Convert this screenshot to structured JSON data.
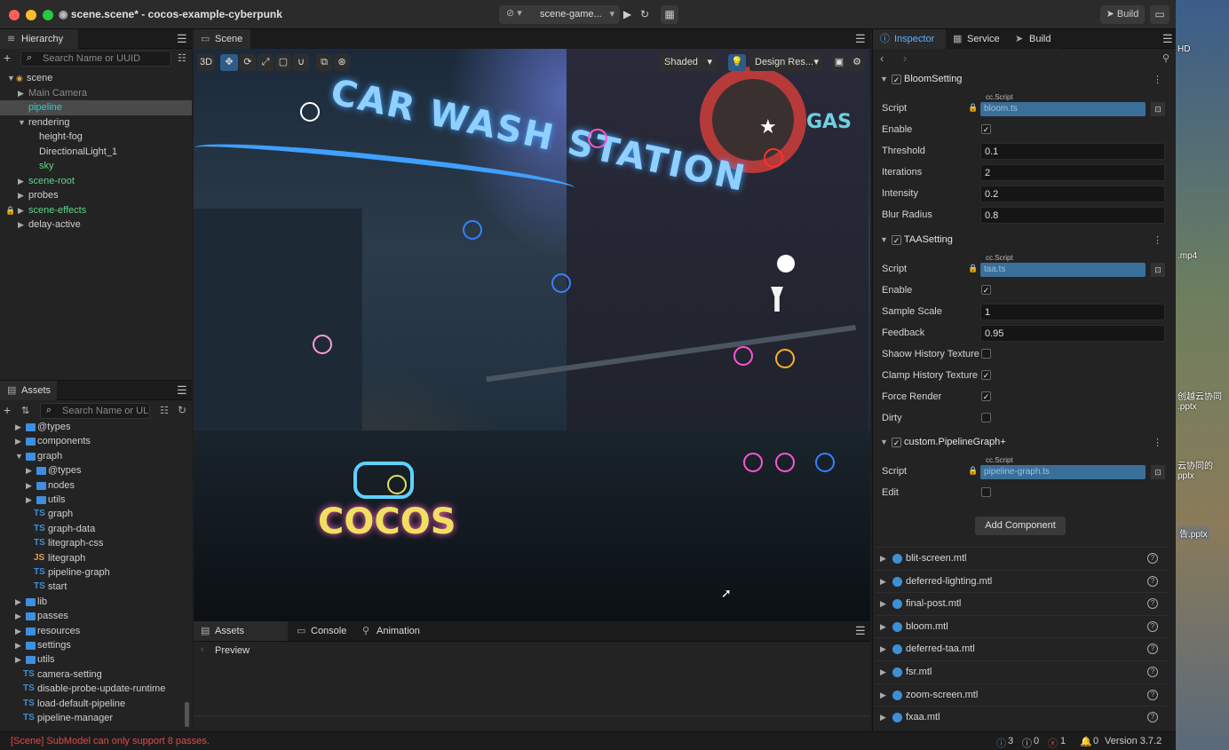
{
  "window": {
    "title": "scene.scene* - cocos-example-cyberpunk"
  },
  "toolbar": {
    "scene_select": "scene-game...",
    "build_label": "Build"
  },
  "hierarchy": {
    "tab": "Hierarchy",
    "search_placeholder": "Search Name or UUID",
    "items": [
      {
        "label": "scene",
        "level": 0,
        "arrow": "open",
        "color": "normal"
      },
      {
        "label": "Main Camera",
        "level": 1,
        "arrow": "closed",
        "color": "gray"
      },
      {
        "label": "pipeline",
        "level": 1,
        "arrow": "none",
        "color": "green",
        "selected": true
      },
      {
        "label": "rendering",
        "level": 1,
        "arrow": "open",
        "color": "normal"
      },
      {
        "label": "height-fog",
        "level": 2,
        "arrow": "none",
        "color": "normal"
      },
      {
        "label": "DirectionalLight_1",
        "level": 2,
        "arrow": "none",
        "color": "normal"
      },
      {
        "label": "sky",
        "level": 2,
        "arrow": "none",
        "color": "green"
      },
      {
        "label": "scene-root",
        "level": 1,
        "arrow": "closed",
        "color": "green"
      },
      {
        "label": "probes",
        "level": 1,
        "arrow": "closed",
        "color": "normal"
      },
      {
        "label": "scene-effects",
        "level": 1,
        "arrow": "closed",
        "color": "green",
        "locked": true
      },
      {
        "label": "delay-active",
        "level": 1,
        "arrow": "closed",
        "color": "normal"
      }
    ]
  },
  "assets": {
    "tab": "Assets",
    "search_placeholder": "Search Name or UL",
    "items": [
      {
        "label": "@types",
        "level": 1,
        "kind": "folder",
        "arrow": "closed"
      },
      {
        "label": "components",
        "level": 1,
        "kind": "folder",
        "arrow": "closed"
      },
      {
        "label": "graph",
        "level": 1,
        "kind": "folder",
        "arrow": "open"
      },
      {
        "label": "@types",
        "level": 2,
        "kind": "folder",
        "arrow": "closed"
      },
      {
        "label": "nodes",
        "level": 2,
        "kind": "folder",
        "arrow": "closed"
      },
      {
        "label": "utils",
        "level": 2,
        "kind": "folder",
        "arrow": "closed"
      },
      {
        "label": "graph",
        "level": 2,
        "kind": "ts",
        "arrow": "none"
      },
      {
        "label": "graph-data",
        "level": 2,
        "kind": "ts",
        "arrow": "none"
      },
      {
        "label": "litegraph-css",
        "level": 2,
        "kind": "ts",
        "arrow": "none"
      },
      {
        "label": "litegraph",
        "level": 2,
        "kind": "js",
        "arrow": "none"
      },
      {
        "label": "pipeline-graph",
        "level": 2,
        "kind": "ts",
        "arrow": "none"
      },
      {
        "label": "start",
        "level": 2,
        "kind": "ts",
        "arrow": "none"
      },
      {
        "label": "lib",
        "level": 1,
        "kind": "folder",
        "arrow": "closed"
      },
      {
        "label": "passes",
        "level": 1,
        "kind": "folder",
        "arrow": "closed"
      },
      {
        "label": "resources",
        "level": 1,
        "kind": "folder",
        "arrow": "closed"
      },
      {
        "label": "settings",
        "level": 1,
        "kind": "folder",
        "arrow": "closed"
      },
      {
        "label": "utils",
        "level": 1,
        "kind": "folder",
        "arrow": "closed"
      },
      {
        "label": "camera-setting",
        "level": 1,
        "kind": "ts",
        "arrow": "none"
      },
      {
        "label": "disable-probe-update-runtime",
        "level": 1,
        "kind": "ts",
        "arrow": "none"
      },
      {
        "label": "load-default-pipeline",
        "level": 1,
        "kind": "ts",
        "arrow": "none"
      },
      {
        "label": "pipeline-manager",
        "level": 1,
        "kind": "ts",
        "arrow": "none"
      }
    ]
  },
  "scene": {
    "tab": "Scene",
    "mode_3d": "3D",
    "shading": "Shaded",
    "design_res": "Design Res...",
    "signs": {
      "carwash": "CAR WASH STATION",
      "cocos": "COCOS",
      "gas": "GAS"
    }
  },
  "bottom": {
    "tabs": [
      "Assets Preview",
      "Console",
      "Animation"
    ]
  },
  "inspector": {
    "tabs": [
      "Inspector",
      "Service",
      "Build"
    ],
    "script_tag": "cc.Script",
    "bloom": {
      "title": "BloomSetting",
      "script": "bloom.ts",
      "labels": {
        "script": "Script",
        "enable": "Enable",
        "threshold": "Threshold",
        "iterations": "Iterations",
        "intensity": "Intensity",
        "blur_radius": "Blur Radius"
      },
      "enable": true,
      "threshold": "0.1",
      "iterations": "2",
      "intensity": "0.2",
      "blur_radius": "0.8"
    },
    "taa": {
      "title": "TAASetting",
      "script": "taa.ts",
      "labels": {
        "script": "Script",
        "enable": "Enable",
        "sample_scale": "Sample Scale",
        "feedback": "Feedback",
        "shaow_history": "Shaow History Texture",
        "clamp_history": "Clamp History Texture",
        "force_render": "Force Render",
        "dirty": "Dirty"
      },
      "enable": true,
      "sample_scale": "1",
      "feedback": "0.95",
      "shaow_history": false,
      "clamp_history": true,
      "force_render": true,
      "dirty": false
    },
    "pipeline_graph": {
      "title": "custom.PipelineGraph+",
      "script": "pipeline-graph.ts",
      "labels": {
        "script": "Script",
        "edit": "Edit"
      },
      "edit": false
    },
    "add_component": "Add Component",
    "assets": [
      "blit-screen.mtl",
      "deferred-lighting.mtl",
      "final-post.mtl",
      "bloom.mtl",
      "deferred-taa.mtl",
      "fsr.mtl",
      "zoom-screen.mtl",
      "fxaa.mtl"
    ]
  },
  "status": {
    "message": "[Scene] SubModel can only support 8 passes.",
    "info_count": "3",
    "warn_count": "0",
    "error_count": "1",
    "notif_count": "0",
    "version": "Version 3.7.2"
  },
  "desktop": {
    "labels": [
      "HD",
      ".mp4",
      "创越云协同\n.pptx",
      "云协同的\npptx",
      "告.pptx"
    ]
  },
  "colors": {
    "accent": "#3d8fd8",
    "selected_row": "#4a4a4a",
    "error": "#e04a4a"
  }
}
